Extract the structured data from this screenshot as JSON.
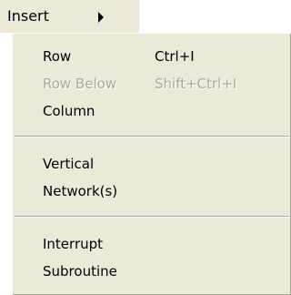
{
  "parent": {
    "label": "Insert"
  },
  "menu": {
    "row": {
      "label": "Row",
      "shortcut": "Ctrl+I",
      "enabled": true
    },
    "row_below": {
      "label": "Row Below",
      "shortcut": "Shift+Ctrl+I",
      "enabled": false
    },
    "column": {
      "label": "Column",
      "enabled": true
    },
    "vertical": {
      "label": "Vertical",
      "enabled": true
    },
    "networks": {
      "label": "Network(s)",
      "enabled": true
    },
    "interrupt": {
      "label": "Interrupt",
      "enabled": true
    },
    "subroutine": {
      "label": "Subroutine",
      "enabled": true
    }
  },
  "colors": {
    "menu_background": "#ece9d8",
    "disabled_text": "#aca899",
    "text": "#000000"
  }
}
